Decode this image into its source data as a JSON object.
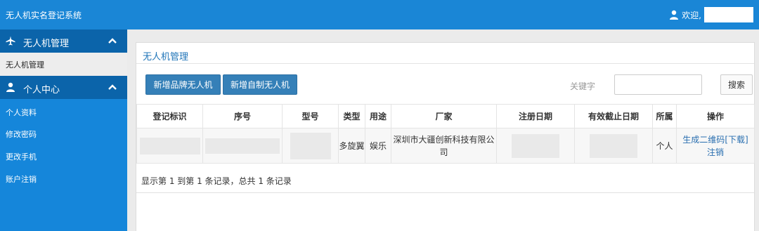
{
  "app": {
    "title": "无人机实名登记系统",
    "welcome": "欢迎,",
    "username": ""
  },
  "sidebar": {
    "groups": [
      {
        "label": "无人机管理",
        "icon": "plane-icon",
        "items": [
          {
            "label": "无人机管理",
            "active": true
          }
        ]
      },
      {
        "label": "个人中心",
        "icon": "user-icon",
        "items": [
          {
            "label": "个人资料"
          },
          {
            "label": "修改密码"
          },
          {
            "label": "更改手机"
          },
          {
            "label": "账户注销"
          }
        ]
      }
    ]
  },
  "main": {
    "title": "无人机管理",
    "buttons": {
      "add_brand": "新增品牌无人机",
      "add_custom": "新增自制无人机"
    },
    "search": {
      "label": "关键字",
      "value": "",
      "button": "搜索"
    },
    "table": {
      "headers": [
        "登记标识",
        "序号",
        "型号",
        "类型",
        "用途",
        "厂家",
        "注册日期",
        "有效截止日期",
        "所属",
        "操作"
      ],
      "rows": [
        {
          "reg_id": "",
          "serial": "",
          "model": "",
          "type": "多旋翼",
          "usage": "娱乐",
          "maker": "深圳市大疆创新科技有限公司",
          "reg_date": "",
          "expiry": "",
          "owner": "个人",
          "actions": {
            "qr": "生成二维码",
            "download": "[下载]",
            "cancel": "注销"
          }
        }
      ]
    },
    "footer": "显示第 1 到第 1 条记录，总共 1 条记录"
  },
  "colors": {
    "topbar": "#1a86d6",
    "sidebar": "#1586da",
    "sidebar_header": "#0b64aa",
    "button": "#3580b8",
    "link": "#2a6fb0"
  }
}
